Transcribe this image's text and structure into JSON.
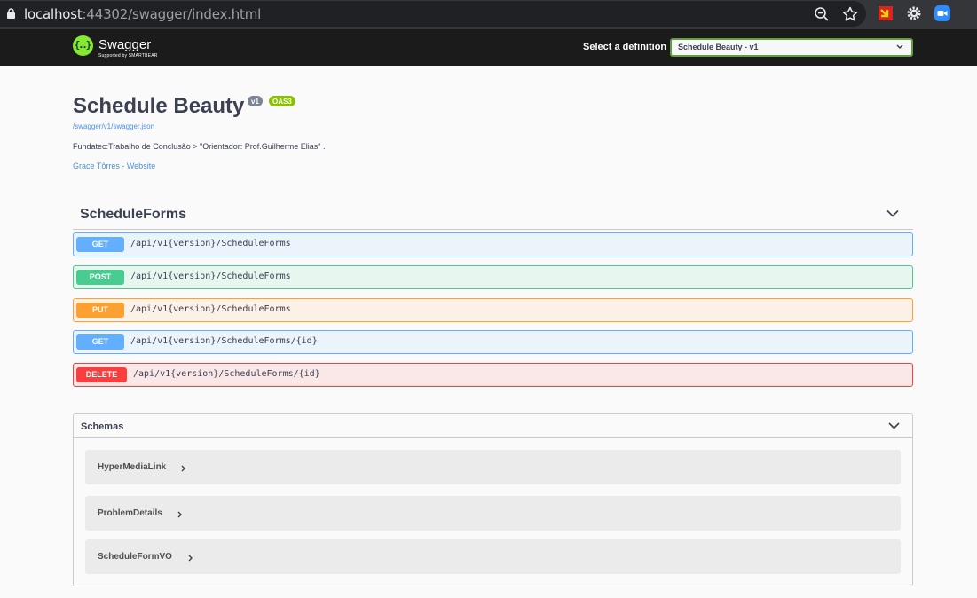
{
  "browser": {
    "url_host": "localhost",
    "url_rest": ":44302/swagger/index.html"
  },
  "topbar": {
    "logo_glyph": "{…}",
    "logo_text": "Swagger",
    "logo_sub": "Supported by SMARTBEAR",
    "definition_label": "Select a definition",
    "definition_value": "Schedule Beauty - v1"
  },
  "info": {
    "title": "Schedule Beauty",
    "version_badge": "v1",
    "oas_badge": "OAS3",
    "spec_link": "/swagger/v1/swagger.json",
    "description": "Fundatec:Trabalho de Conclusão > \"Orientador: Prof.Guilherme Elias\" .",
    "contact": "Grace Tôrres - Website"
  },
  "tag": {
    "name": "ScheduleForms"
  },
  "operations": [
    {
      "method": "GET",
      "path": "/api/v1{version}/ScheduleForms"
    },
    {
      "method": "POST",
      "path": "/api/v1{version}/ScheduleForms"
    },
    {
      "method": "PUT",
      "path": "/api/v1{version}/ScheduleForms"
    },
    {
      "method": "GET",
      "path": "/api/v1{version}/ScheduleForms/{id}"
    },
    {
      "method": "DELETE",
      "path": "/api/v1{version}/ScheduleForms/{id}"
    }
  ],
  "schemas": {
    "title": "Schemas",
    "models": [
      "HyperMediaLink",
      "ProblemDetails",
      "ScheduleFormVO"
    ]
  },
  "colors": {
    "get": "#61affe",
    "post": "#49cc90",
    "put": "#fca130",
    "delete": "#f93e3e",
    "swagger_green": "#85ea2d"
  }
}
